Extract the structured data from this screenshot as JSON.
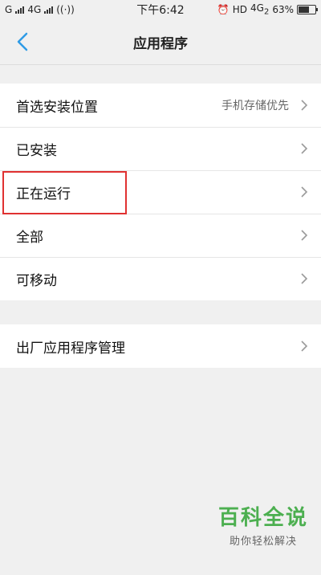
{
  "status_bar": {
    "carrier_left": "G",
    "network": "4G",
    "time": "下午6:42",
    "hd": "HD",
    "net2": "4G",
    "net2_sub": "2",
    "battery_text": "63%",
    "battery_level": 0.63
  },
  "header": {
    "title": "应用程序"
  },
  "group1": {
    "items": [
      {
        "label": "首选安装位置",
        "value": "手机存储优先"
      },
      {
        "label": "已安装",
        "value": ""
      },
      {
        "label": "正在运行",
        "value": ""
      },
      {
        "label": "全部",
        "value": ""
      },
      {
        "label": "可移动",
        "value": ""
      }
    ]
  },
  "group2": {
    "items": [
      {
        "label": "出厂应用程序管理",
        "value": ""
      }
    ]
  },
  "colors": {
    "accent": "#2f9be6",
    "highlight": "#e03131",
    "watermark": "#4caf50"
  },
  "watermark": {
    "title": "百科全说",
    "subtitle": "助你轻松解决"
  }
}
